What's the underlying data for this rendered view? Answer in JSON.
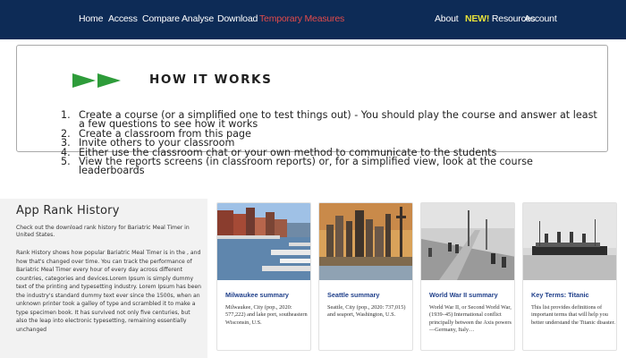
{
  "nav": {
    "left": [
      "Home",
      "Access",
      "Compare",
      "Analyse",
      "Download",
      "Temporary Measures"
    ],
    "right": {
      "about": "About",
      "new_badge": "NEW!",
      "resources": " Resources",
      "account": "Account"
    }
  },
  "how_it_works": {
    "title": "HOW IT WORKS",
    "steps": [
      {
        "num": "1.",
        "text": "Create a course (or a simplified one to test things out) - You should play the course and answer at least a few questions to see how it works"
      },
      {
        "num": "2.",
        "text": "Create a classroom from this page"
      },
      {
        "num": "3.",
        "text": "Invite others to your classroom"
      },
      {
        "num": "4.",
        "text": "Either use the classroom chat or your own method to communicate to the students"
      },
      {
        "num": "5.",
        "text": "View the reports screens (in classroom reports) or, for a simplified view, look at the course leaderboards"
      }
    ]
  },
  "rank_history": {
    "title": "App Rank History",
    "intro": "Check out the download rank history for Bariatric Meal Timer in United States.",
    "body": "Rank History shows how popular Bariatric Meal Timer is in the , and how that's changed over time. You can track the performance of Bariatric Meal Timer every hour of every day across different countries, categories and devices.Lorem Ipsum is simply dummy text of the printing and typesetting industry. Lorem Ipsum has been the industry's standard dummy text ever since the 1500s, when an unknown printer took a galley of type and scrambled it to make a type specimen book. It has survived not only five centuries, but also the leap into electronic typesetting, remaining essentially unchanged"
  },
  "cards": [
    {
      "title": "Milwaukee summary",
      "desc": "Milwaukee, City (pop., 2020: 577,222) and lake port, southeastern Wisconsin, U.S.",
      "image": "harbor-city-photo"
    },
    {
      "title": "Seattle summary",
      "desc": "Seattle, City (pop., 2020: 737,015) and seaport, Washington, U.S.",
      "image": "city-skyline-photo"
    },
    {
      "title": "World War II summary",
      "desc": "World War II, or Second World War, (1939–45) International conflict principally between the Axis powers—Germany, Italy…",
      "image": "war-soldiers-photo"
    },
    {
      "title": "Key Terms: Titanic",
      "desc": "This list provides definitions of important terms that will help you better understand the Titanic disaster.",
      "image": "ship-photo"
    }
  ],
  "colors": {
    "nav_bg": "#0d2b56",
    "nav_active": "#e24b4b",
    "new_badge": "#e8e23a",
    "arrow_green": "#2e9c3a",
    "card_title": "#1f3f8a"
  }
}
